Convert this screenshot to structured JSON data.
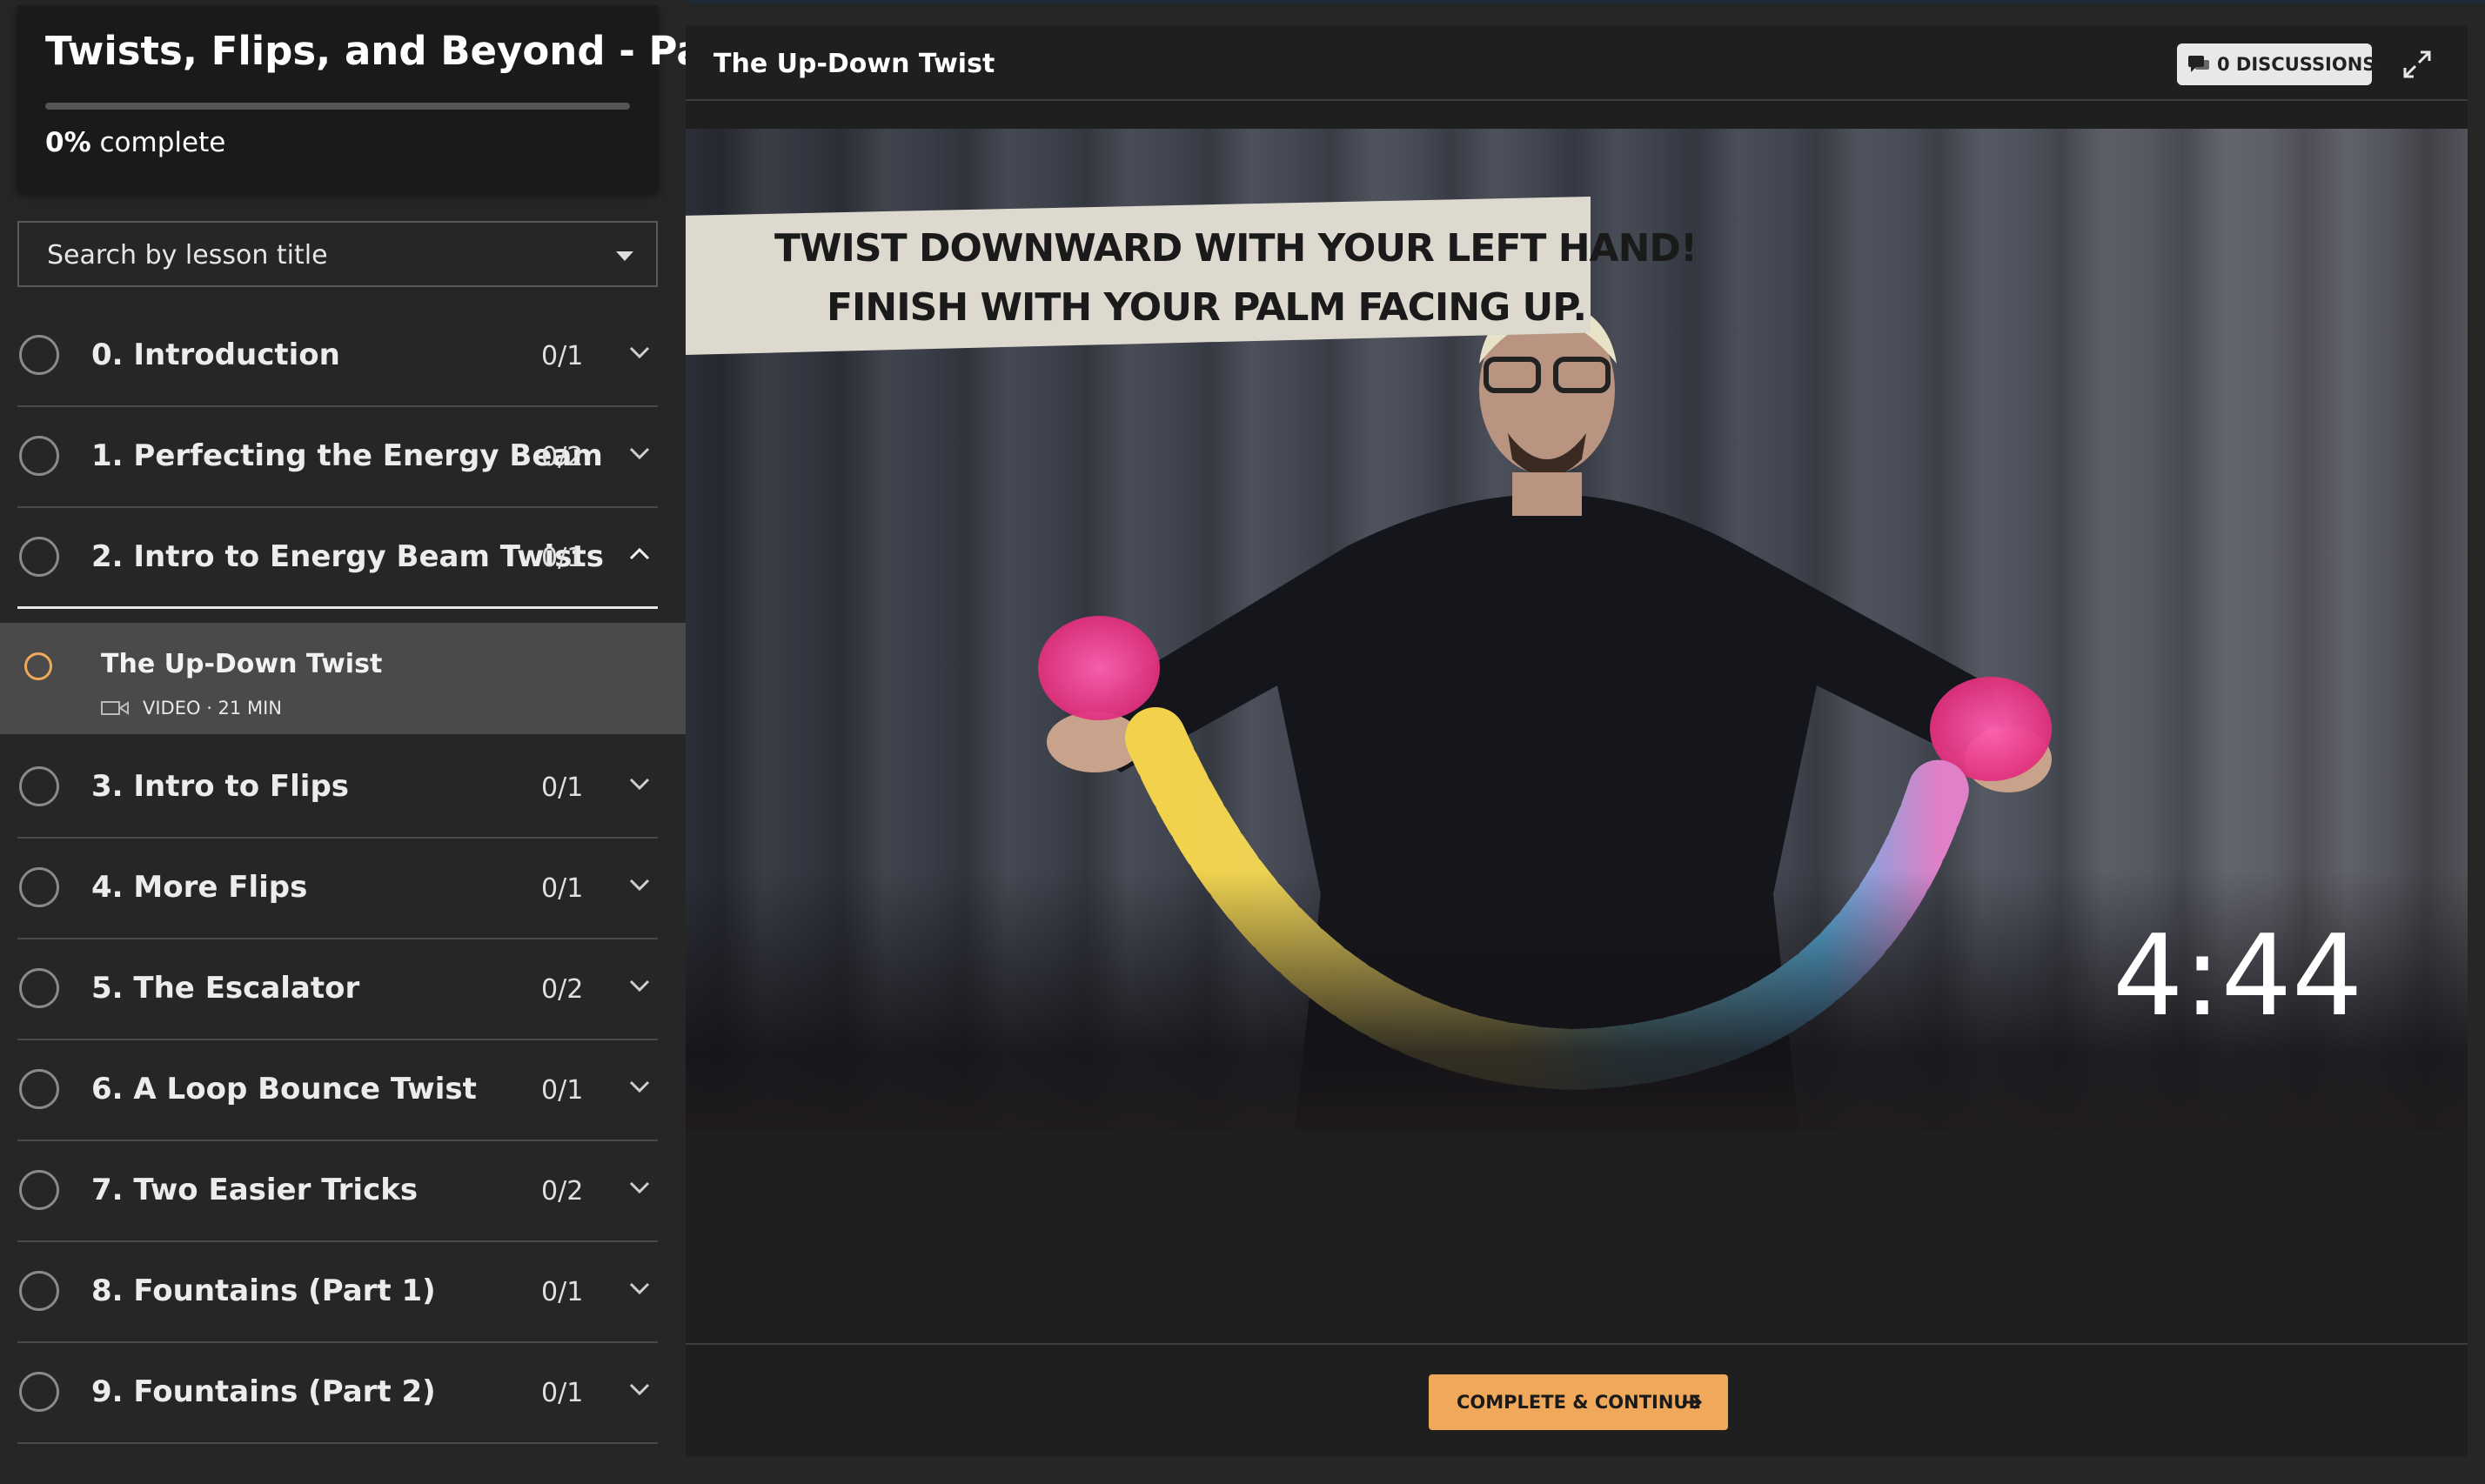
{
  "course": {
    "title": "Twists, Flips, and Beyond - Part I",
    "progress_percent": "0%",
    "progress_suffix": "complete",
    "progress_fraction": 0
  },
  "search": {
    "placeholder": "Search by lesson title"
  },
  "sections_before": [
    {
      "title": "0. Introduction",
      "count": "0/1"
    },
    {
      "title": "1. Perfecting the Energy Beam",
      "count": "0/2"
    }
  ],
  "open_section": {
    "title": "2. Intro to Energy Beam Twists",
    "count": "0/1"
  },
  "current_lesson": {
    "title": "The Up-Down Twist",
    "meta": "VIDEO · 21 MIN",
    "icon": "video-camera-icon"
  },
  "sections_after": [
    {
      "title": "3. Intro to Flips",
      "count": "0/1"
    },
    {
      "title": "4. More Flips",
      "count": "0/1"
    },
    {
      "title": "5. The Escalator",
      "count": "0/2"
    },
    {
      "title": "6. A Loop Bounce Twist",
      "count": "0/1"
    },
    {
      "title": "7. Two Easier Tricks",
      "count": "0/2"
    },
    {
      "title": "8. Fountains (Part 1)",
      "count": "0/1"
    },
    {
      "title": "9. Fountains (Part 2)",
      "count": "0/1"
    }
  ],
  "main": {
    "lesson_title": "The Up-Down Twist",
    "discussions_label": "0 DISCUSSIONS",
    "video": {
      "caption_line1": "TWIST DOWNWARD WITH YOUR LEFT HAND!",
      "caption_line2": "FINISH WITH YOUR PALM FACING UP.",
      "timer": "4:44"
    },
    "cta_label": "COMPLETE & CONTINUE"
  },
  "colors": {
    "accent": "#f0a95a",
    "background": "#262626",
    "panel": "#1f1f1f"
  }
}
